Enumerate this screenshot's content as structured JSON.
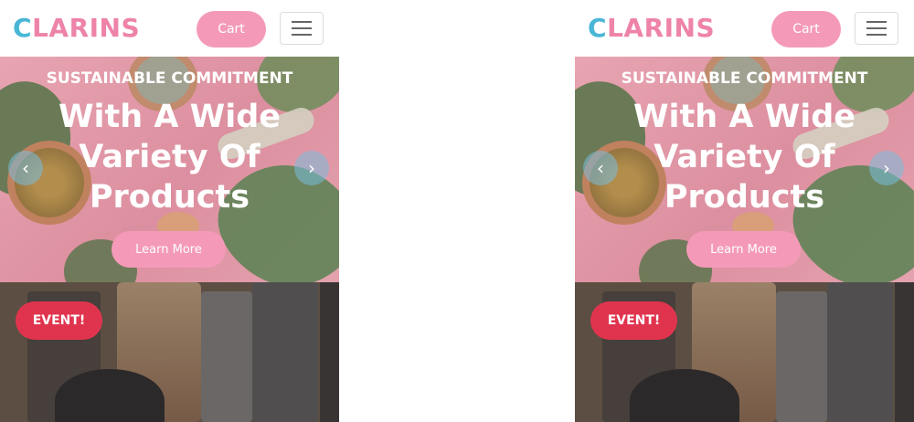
{
  "brand": {
    "logo_first": "C",
    "logo_rest": "LARINS",
    "accent_blue": "#4ab6d6",
    "accent_pink": "#ee83a9"
  },
  "nav": {
    "cart_label": "Cart",
    "menu_icon": "hamburger-icon"
  },
  "hero": {
    "subtitle": "SUSTAINABLE COMMITMENT",
    "title": "With A Wide Variety Of Products",
    "cta_label": "Learn More",
    "prev_icon": "chevron-left-icon",
    "next_icon": "chevron-right-icon",
    "prev_glyph": "‹",
    "next_glyph": "›"
  },
  "event": {
    "badge_label": "EVENT!",
    "badge_color": "#e0344e"
  }
}
